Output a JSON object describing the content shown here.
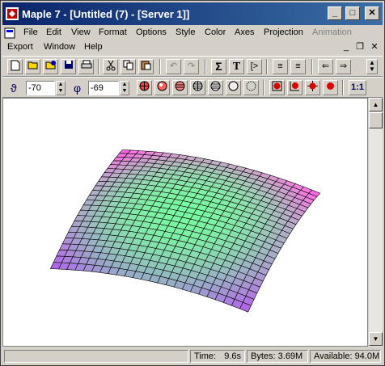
{
  "window": {
    "title": "Maple 7  - [Untitled (7) - [Server 1]]",
    "minimize_label": "_",
    "maximize_label": "□",
    "close_label": "✕"
  },
  "menubar": {
    "row1": [
      "File",
      "Edit",
      "View",
      "Format",
      "Options",
      "Style",
      "Color",
      "Axes",
      "Projection",
      "Animation"
    ],
    "row2": [
      "Export",
      "Window",
      "Help"
    ]
  },
  "toolbar": {
    "sum_glyph": "Σ",
    "text_glyph": "T",
    "prompt_glyph": "[>",
    "back_glyph": "⇐",
    "forward_glyph": "⇒"
  },
  "plot_toolbar": {
    "theta_symbol": "ϑ",
    "theta_value": "-70",
    "phi_symbol": "φ",
    "phi_value": "-69",
    "ratio_label": "1:1"
  },
  "status": {
    "time_label": "Time:",
    "time_value": "9.6s",
    "bytes_label": "Bytes:",
    "bytes_value": "3.69M",
    "available_label": "Available:",
    "available_value": "94.0M"
  }
}
